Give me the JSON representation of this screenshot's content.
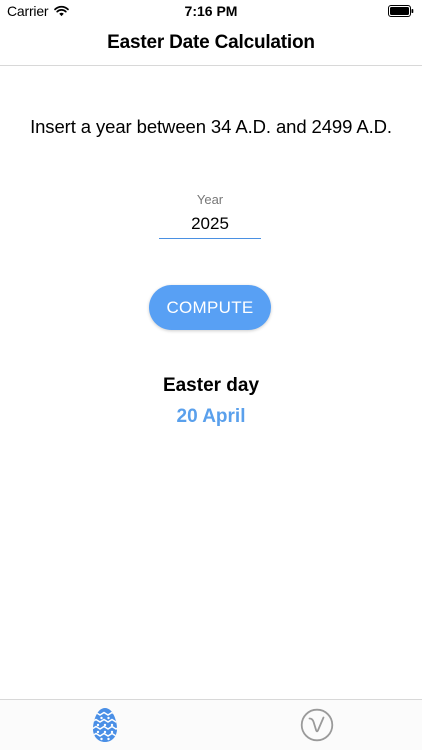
{
  "status_bar": {
    "carrier": "Carrier",
    "time": "7:16 PM",
    "icons": [
      "wifi-icon",
      "battery-icon"
    ]
  },
  "nav": {
    "title": "Easter Date Calculation"
  },
  "main": {
    "instruction": "Insert a year between 34 A.D. and 2499 A.D.",
    "year_field": {
      "label": "Year",
      "value": "2025"
    },
    "compute_button": {
      "label": "COMPUTE"
    },
    "result": {
      "heading": "Easter day",
      "value": "20 April"
    }
  },
  "tab_bar": {
    "items": [
      {
        "icon": "easter-egg-icon",
        "selected": true
      },
      {
        "icon": "check-circle-icon",
        "selected": false
      }
    ]
  },
  "colors": {
    "accent": "#58a0f4",
    "result_text": "#5aa0ec",
    "input_underline": "#4a90e2",
    "tab_inactive": "#9a9a9a"
  }
}
